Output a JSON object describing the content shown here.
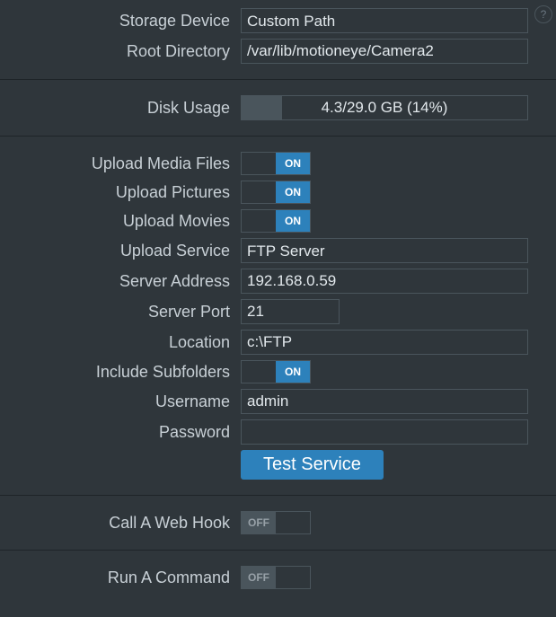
{
  "storage": {
    "device_label": "Storage Device",
    "device_value": "Custom Path",
    "root_dir_label": "Root Directory",
    "root_dir_value": "/var/lib/motioneye/Camera2"
  },
  "disk": {
    "label": "Disk Usage",
    "text": "4.3/29.0 GB (14%)",
    "percent": 14
  },
  "upload": {
    "media_label": "Upload Media Files",
    "pictures_label": "Upload Pictures",
    "movies_label": "Upload Movies",
    "service_label": "Upload Service",
    "service_value": "FTP Server",
    "server_addr_label": "Server Address",
    "server_addr_value": "192.168.0.59",
    "server_port_label": "Server Port",
    "server_port_value": "21",
    "location_label": "Location",
    "location_value": "c:\\FTP",
    "subfolders_label": "Include Subfolders",
    "username_label": "Username",
    "username_value": "admin",
    "password_label": "Password",
    "password_value": "",
    "test_button": "Test Service",
    "media_on": true,
    "pictures_on": true,
    "movies_on": true,
    "subfolders_on": true
  },
  "webhook": {
    "label": "Call A Web Hook",
    "on": false
  },
  "command": {
    "label": "Run A Command",
    "on": false
  },
  "toggle_text": {
    "on": "ON",
    "off": "OFF"
  },
  "help_icon": "?"
}
